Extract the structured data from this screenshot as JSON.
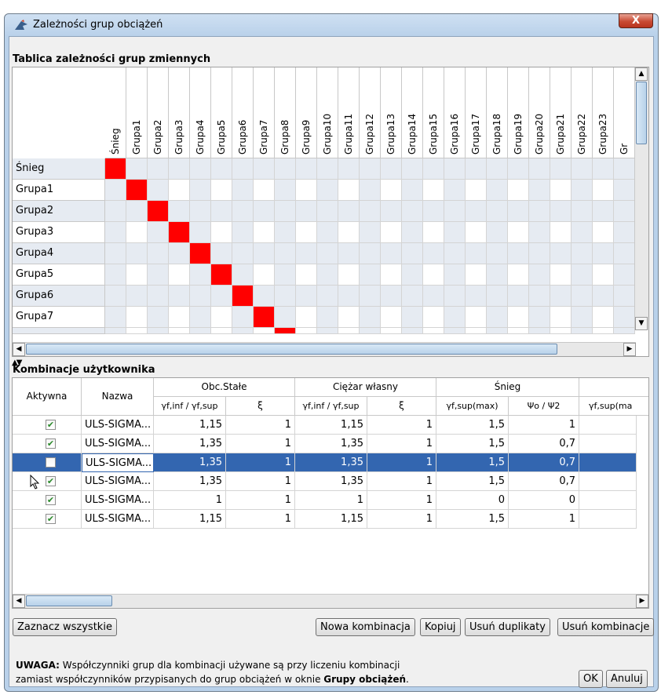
{
  "window": {
    "title": "Zależności grup obciążeń",
    "close_label": "X"
  },
  "dependency": {
    "title": "Tablica zależności grup zmiennych",
    "columns": [
      "Śnieg",
      "Grupa1",
      "Grupa2",
      "Grupa3",
      "Grupa4",
      "Grupa5",
      "Grupa6",
      "Grupa7",
      "Grupa8",
      "Grupa9",
      "Grupa10",
      "Grupa11",
      "Grupa12",
      "Grupa13",
      "Grupa14",
      "Grupa15",
      "Grupa16",
      "Grupa17",
      "Grupa18",
      "Grupa19",
      "Grupa20",
      "Grupa21",
      "Grupa22",
      "Grupa23",
      "Gr"
    ],
    "rows": [
      "Śnieg",
      "Grupa1",
      "Grupa2",
      "Grupa3",
      "Grupa4",
      "Grupa5",
      "Grupa6",
      "Grupa7"
    ],
    "colors": {
      "self": "#ff0000",
      "shaded": "#e6ebf2",
      "plain": "#ffffff"
    }
  },
  "combinations": {
    "title": "Kombinacje użytkownika",
    "headers": {
      "active": "Aktywna",
      "name": "Nazwa",
      "groups": [
        "Obc.Stałe",
        "Ciężar własny",
        "Śnieg"
      ],
      "sub": [
        "γf,inf / γf,sup",
        "ξ",
        "γf,inf / γf,sup",
        "ξ",
        "γf,sup(max)",
        "Ψo / Ψ2",
        "γf,sup(ma"
      ]
    },
    "rows": [
      {
        "active": true,
        "name": "ULS-SIGMA...",
        "v": [
          "1,15",
          "1",
          "1,15",
          "1",
          "1,5",
          "1"
        ]
      },
      {
        "active": true,
        "name": "ULS-SIGMA...",
        "v": [
          "1,35",
          "1",
          "1,35",
          "1",
          "1,5",
          "0,7"
        ]
      },
      {
        "active": false,
        "name": "ULS-SIGMA...",
        "v": [
          "1,35",
          "1",
          "1,35",
          "1",
          "1,5",
          "0,7"
        ],
        "selected": true
      },
      {
        "active": true,
        "name": "ULS-SIGMA...",
        "v": [
          "1,35",
          "1",
          "1,35",
          "1",
          "1,5",
          "0,7"
        ]
      },
      {
        "active": true,
        "name": "ULS-SIGMA...",
        "v": [
          "1",
          "1",
          "1",
          "1",
          "0",
          "0"
        ]
      },
      {
        "active": true,
        "name": "ULS-SIGMA...",
        "v": [
          "1,15",
          "1",
          "1,15",
          "1",
          "1,5",
          "1"
        ]
      }
    ]
  },
  "buttons": {
    "select_all": "Zaznacz wszystkie",
    "new_combination": "Nowa kombinacja",
    "copy": "Kopiuj",
    "remove_duplicates": "Usuń duplikaty",
    "remove_combinations": "Usuń kombinacje",
    "ok": "OK",
    "cancel": "Anuluj"
  },
  "note": {
    "bold_prefix": "UWAGA:",
    "line1": " Współczynniki grup dla kombinacji używane są przy liczeniu kombinacji",
    "line2_prefix": "zamiast współczynników przypisanych do grup obciążeń w oknie ",
    "line2_bold": "Grupy obciążeń",
    "line2_suffix": "."
  }
}
